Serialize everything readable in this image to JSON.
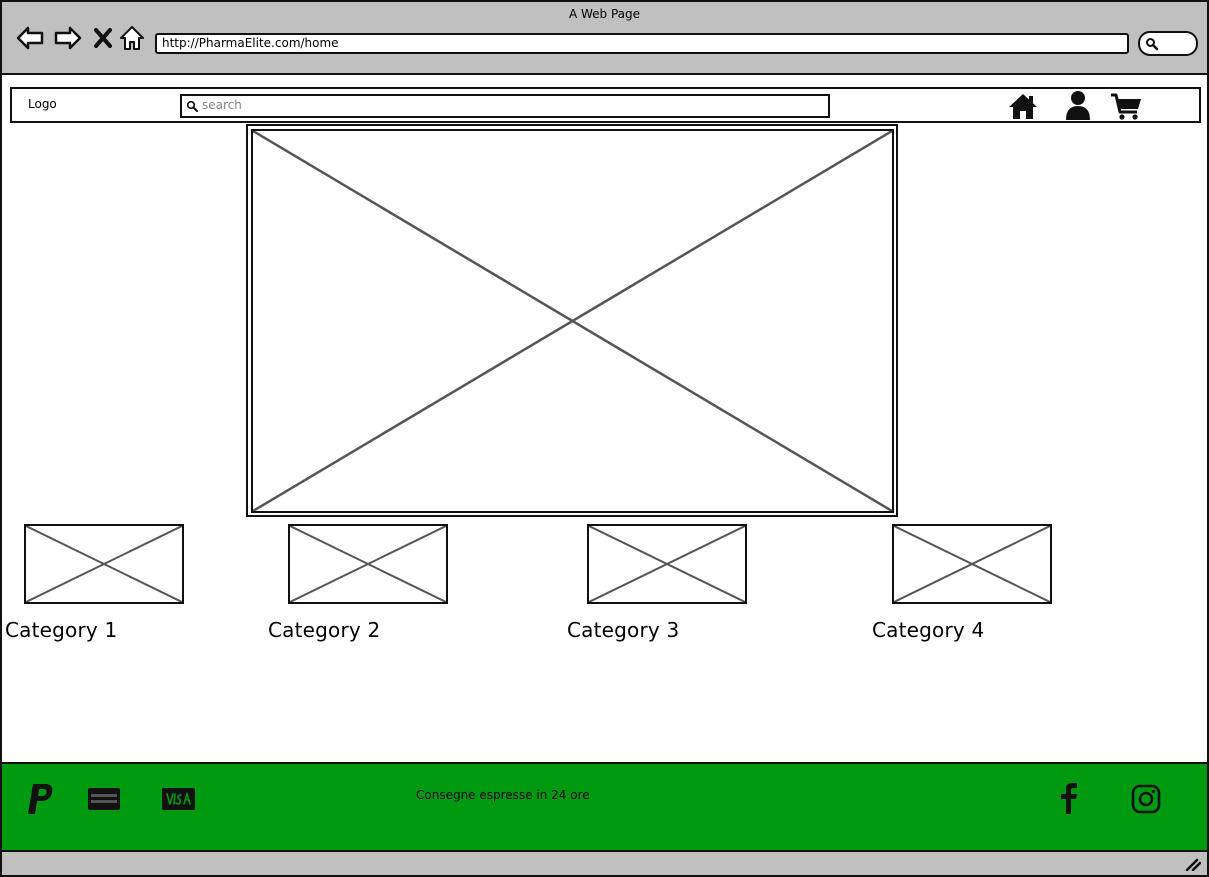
{
  "window": {
    "title": "A Web Page"
  },
  "browser": {
    "url": "http://PharmaElite.com/home",
    "nav_icons": [
      "back-arrow-icon",
      "forward-arrow-icon",
      "stop-icon",
      "home-icon"
    ],
    "search_icon": "search-icon"
  },
  "header": {
    "logo": "Logo",
    "search_placeholder": "search",
    "icons": [
      "home-icon",
      "user-icon",
      "cart-icon"
    ]
  },
  "hero": {
    "type": "image-placeholder"
  },
  "categories": [
    {
      "label": "Category 1"
    },
    {
      "label": "Category 2"
    },
    {
      "label": "Category 3"
    },
    {
      "label": "Category 4"
    }
  ],
  "footer": {
    "text": "Consegne espresse in 24 ore",
    "payment_icons": [
      "paypal-icon",
      "amex-icon",
      "visa-icon"
    ],
    "social_icons": [
      "facebook-icon",
      "instagram-icon"
    ],
    "background": "#009a10"
  },
  "colors": {
    "chrome": "#c0c0c0",
    "footer": "#009a10",
    "placeholder_line": "#555555"
  }
}
